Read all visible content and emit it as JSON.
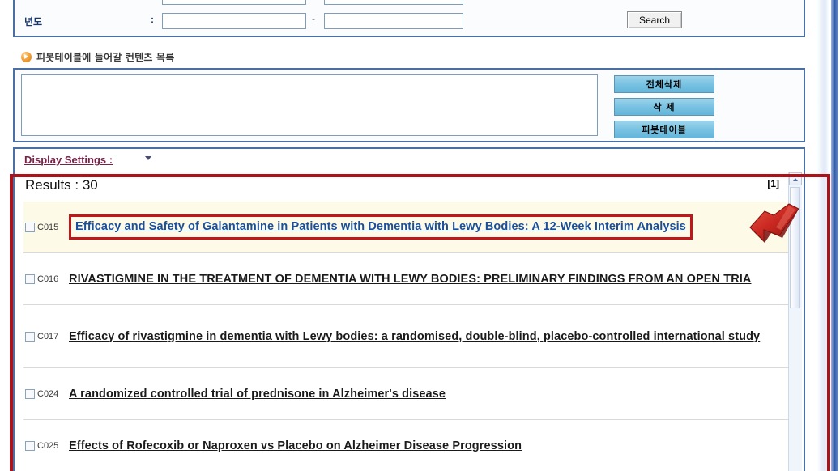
{
  "search_panel": {
    "year_label": "년도",
    "colon": ":",
    "dash": "-",
    "year_from_value": "",
    "year_to_value": "",
    "year_from_placeholder": "",
    "year_to_placeholder": "",
    "partial_from_value": "",
    "partial_to_value": "",
    "search_button_label": "Search"
  },
  "contents_section": {
    "title": "피봇테이블에 들어갈 컨텐츠 목록",
    "bullet_icon": "play-bullet-icon",
    "listbox_value": "",
    "buttons": [
      {
        "label": "전체삭제",
        "name": "delete-all-button"
      },
      {
        "label": "삭    제",
        "name": "delete-button"
      },
      {
        "label": "피봇테이블",
        "name": "pivot-table-button"
      }
    ]
  },
  "results_panel": {
    "display_settings_label": "Display Settings :",
    "display_settings_icon": "chevron-down-icon",
    "results_label": "Results : 30",
    "results_count": 30,
    "page_indicator": "[1]",
    "scroll_up_icon": "chevron-up-icon",
    "rows": [
      {
        "id": "C015",
        "title": "Efficacy and Safety of Galantamine in Patients with Dementia with Lewy Bodies: A 12-Week Interim Analysis",
        "checked": false,
        "highlighted": true,
        "boxed": true,
        "link_blue": true
      },
      {
        "id": "C016",
        "title": "RIVASTIGMINE IN THE TREATMENT OF DEMENTIA WITH LEWY BODIES: PRELIMINARY FINDINGS FROM AN OPEN TRIA",
        "checked": false,
        "highlighted": false,
        "boxed": false,
        "link_blue": false
      },
      {
        "id": "C017",
        "title": "Efficacy of rivastigmine in dementia with Lewy bodies: a randomised, double-blind, placebo-controlled international study",
        "checked": false,
        "highlighted": false,
        "boxed": false,
        "link_blue": false
      },
      {
        "id": "C024",
        "title": "A randomized controlled trial of prednisone in Alzheimer's disease",
        "checked": false,
        "highlighted": false,
        "boxed": false,
        "link_blue": false
      },
      {
        "id": "C025",
        "title": "Effects of Rofecoxib or Naproxen vs Placebo on Alzheimer Disease Progression",
        "checked": false,
        "highlighted": false,
        "boxed": false,
        "link_blue": false
      }
    ]
  },
  "annotations": {
    "highlight_rect_color": "#b01118",
    "arrow_icon": "red-arrow-pointing-down-left",
    "arrow_color": "#c42b22"
  },
  "colors": {
    "panel_border": "#4a6fa5",
    "link_blue": "#1b4f9c",
    "display_settings": "#7a2145",
    "button_blue": "#79c2e2",
    "highlight_row": "#fdfbe8"
  }
}
